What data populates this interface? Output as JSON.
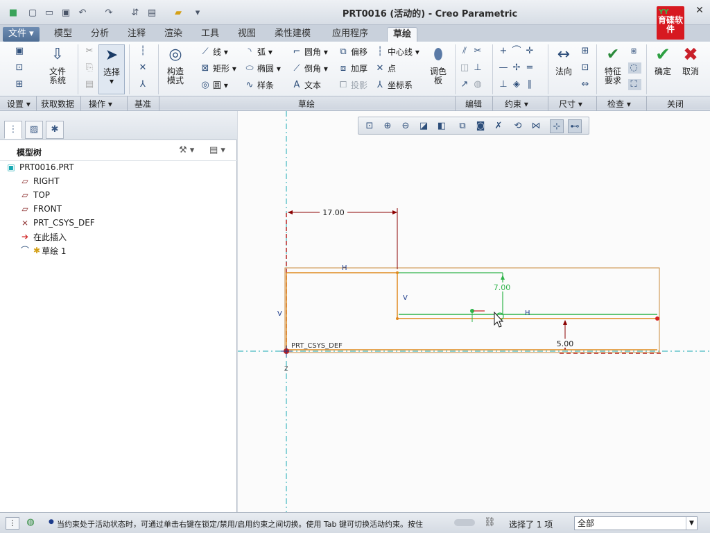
{
  "window": {
    "title": "PRT0016 (活动的) - Creo Parametric",
    "logo_text": "育碟软件"
  },
  "quick_access": {
    "icons": [
      "app-icon",
      "new-icon",
      "open-icon",
      "save-icon",
      "undo-icon",
      "redo-icon",
      "regenerate-icon",
      "windows-icon",
      "close-window-icon",
      "customize-icon"
    ]
  },
  "tabs": [
    "文件",
    "模型",
    "分析",
    "注释",
    "渲染",
    "工具",
    "视图",
    "柔性建模",
    "应用程序",
    "草绘"
  ],
  "active_tab": "草绘",
  "ribbon": {
    "coordinate_system": "文件\n系统",
    "select": "选择",
    "construction_mode": "构造\n模式",
    "line": "线",
    "arc": "弧",
    "fillet": "圆角",
    "offset": "偏移",
    "centerline": "中心线",
    "rectangle": "矩形",
    "ellipse": "椭圆",
    "chamfer": "倒角",
    "thicken": "加厚",
    "point": "点",
    "circle": "圆",
    "spline": "样条",
    "text": "文本",
    "project": "投影",
    "coord_sys": "坐标系",
    "palette": "调色\n板",
    "normal": "法向",
    "feature_req": "特征\n要求",
    "ok": "确定",
    "cancel": "取消"
  },
  "groups": {
    "setup": "设置",
    "get_data": "获取数据",
    "operations": "操作",
    "datum": "基准",
    "sketching": "草绘",
    "editing": "编辑",
    "constrain": "约束",
    "dimension": "尺寸",
    "inspect": "检查",
    "close": "关闭"
  },
  "model_tree": {
    "title": "模型树",
    "items": [
      {
        "label": "PRT0016.PRT",
        "icon": "part-icon"
      },
      {
        "label": "RIGHT",
        "icon": "datum-plane-icon"
      },
      {
        "label": "TOP",
        "icon": "datum-plane-icon"
      },
      {
        "label": "FRONT",
        "icon": "datum-plane-icon"
      },
      {
        "label": "PRT_CSYS_DEF",
        "icon": "csys-icon"
      },
      {
        "label": "在此插入",
        "icon": "insert-arrow-icon"
      },
      {
        "label": "草绘 1",
        "icon": "sketch-icon"
      }
    ]
  },
  "sketch": {
    "dim_horizontal": "17.00",
    "dim_vertical_upper": "7.00",
    "dim_vertical_lower": "5.00",
    "constraint_h": "H",
    "constraint_v": "V",
    "csys_label": "PRT_CSYS_DEF",
    "axis_z": "Z"
  },
  "status": {
    "message": "当约束处于活动状态时，可通过单击右键在锁定/禁用/启用约束之间切换。使用 Tab 键可切换活动约束。按住",
    "selected": "选择了 1 项",
    "filter": "全部"
  },
  "colors": {
    "sketch_orange": "#e08a1e",
    "dimension_red": "#8b0000",
    "constraint_green": "#2fb34a",
    "datum_cyan": "#18a9b3"
  }
}
